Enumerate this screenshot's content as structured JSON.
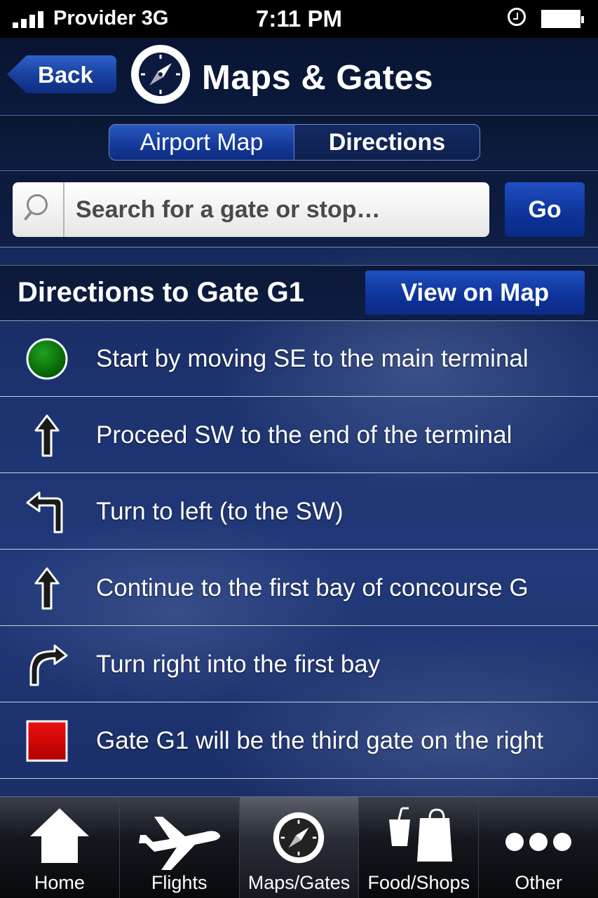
{
  "status_bar": {
    "carrier": "Provider 3G",
    "time": "7:11 PM"
  },
  "header": {
    "back_label": "Back",
    "title": "Maps & Gates",
    "icon": "compass-icon"
  },
  "segments": [
    {
      "label": "Airport Map",
      "selected": false
    },
    {
      "label": "Directions",
      "selected": true
    }
  ],
  "search": {
    "placeholder": "Search for a gate or stop…",
    "value": "",
    "go_label": "Go"
  },
  "directions": {
    "title": "Directions to Gate G1",
    "view_on_map_label": "View on Map",
    "steps": [
      {
        "icon": "start-circle-icon",
        "text": "Start by moving SE to the main terminal"
      },
      {
        "icon": "arrow-up-icon",
        "text": "Proceed SW to the end of the terminal"
      },
      {
        "icon": "turn-left-icon",
        "text": "Turn to left (to the SW)"
      },
      {
        "icon": "arrow-up-icon",
        "text": "Continue to the first bay of concourse G"
      },
      {
        "icon": "turn-right-icon",
        "text": "Turn right into the first bay"
      },
      {
        "icon": "destination-square-icon",
        "text": "Gate G1 will be the third gate on the right"
      }
    ]
  },
  "tabbar": {
    "items": [
      {
        "label": "Home",
        "icon": "home-icon",
        "active": false
      },
      {
        "label": "Flights",
        "icon": "airplane-icon",
        "active": false
      },
      {
        "label": "Maps/Gates",
        "icon": "compass-icon",
        "active": true
      },
      {
        "label": "Food/Shops",
        "icon": "food-shops-icon",
        "active": false
      },
      {
        "label": "Other",
        "icon": "more-dots-icon",
        "active": false
      }
    ]
  },
  "colors": {
    "accent_blue": "#133a98",
    "start_green": "#0a7a0a",
    "destination_red": "#d00000"
  }
}
